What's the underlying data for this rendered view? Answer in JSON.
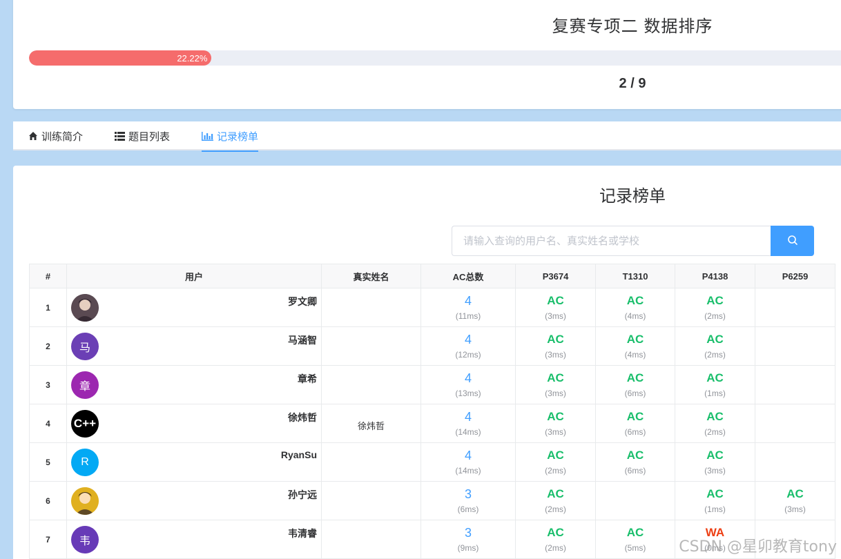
{
  "contest": {
    "title": "复赛专项二 数据排序",
    "progress_percent": 22.22,
    "progress_text": "22.22%",
    "progress_count": "2 / 9",
    "progress_color": "#f56c6c"
  },
  "tabs": [
    {
      "label": "训练简介",
      "icon": "home-icon",
      "active": false
    },
    {
      "label": "题目列表",
      "icon": "list-icon",
      "active": false
    },
    {
      "label": "记录榜单",
      "icon": "bar-chart-icon",
      "active": true
    }
  ],
  "board": {
    "title": "记录榜单",
    "search_placeholder": "请输入查询的用户名、真实姓名或学校",
    "columns": [
      "#",
      "用户",
      "真实姓名",
      "AC总数",
      "P3674",
      "T1310",
      "P4138",
      "P6259"
    ],
    "rows": [
      {
        "rank": "1",
        "user": "罗文卿",
        "avatar": {
          "type": "image",
          "label": "",
          "color": "#5a4a52"
        },
        "realname": "",
        "ac": "4",
        "total_time": "(11ms)",
        "cells": [
          {
            "v": "AC",
            "t": "(3ms)"
          },
          {
            "v": "AC",
            "t": "(4ms)"
          },
          {
            "v": "AC",
            "t": "(2ms)"
          },
          {
            "v": "",
            "t": ""
          }
        ]
      },
      {
        "rank": "2",
        "user": "马涵智",
        "avatar": {
          "type": "letter",
          "label": "马",
          "color": "#6b3fb5"
        },
        "realname": "",
        "ac": "4",
        "total_time": "(12ms)",
        "cells": [
          {
            "v": "AC",
            "t": "(3ms)"
          },
          {
            "v": "AC",
            "t": "(4ms)"
          },
          {
            "v": "AC",
            "t": "(2ms)"
          },
          {
            "v": "",
            "t": ""
          }
        ]
      },
      {
        "rank": "3",
        "user": "章希",
        "avatar": {
          "type": "letter",
          "label": "章",
          "color": "#9c27b0"
        },
        "realname": "",
        "ac": "4",
        "total_time": "(13ms)",
        "cells": [
          {
            "v": "AC",
            "t": "(3ms)"
          },
          {
            "v": "AC",
            "t": "(6ms)"
          },
          {
            "v": "AC",
            "t": "(1ms)"
          },
          {
            "v": "",
            "t": ""
          }
        ]
      },
      {
        "rank": "4",
        "user": "徐炜哲",
        "avatar": {
          "type": "cpp",
          "label": "C++",
          "color": "#000000"
        },
        "realname": "徐炜哲",
        "ac": "4",
        "total_time": "(14ms)",
        "cells": [
          {
            "v": "AC",
            "t": "(3ms)"
          },
          {
            "v": "AC",
            "t": "(6ms)"
          },
          {
            "v": "AC",
            "t": "(2ms)"
          },
          {
            "v": "",
            "t": ""
          }
        ]
      },
      {
        "rank": "5",
        "user": "RyanSu",
        "avatar": {
          "type": "letter",
          "label": "R",
          "color": "#03a9f4"
        },
        "realname": "",
        "ac": "4",
        "total_time": "(14ms)",
        "cells": [
          {
            "v": "AC",
            "t": "(2ms)"
          },
          {
            "v": "AC",
            "t": "(6ms)"
          },
          {
            "v": "AC",
            "t": "(3ms)"
          },
          {
            "v": "",
            "t": ""
          }
        ]
      },
      {
        "rank": "6",
        "user": "孙宁远",
        "avatar": {
          "type": "image",
          "label": "",
          "color": "#e0b020"
        },
        "realname": "",
        "ac": "3",
        "total_time": "(6ms)",
        "cells": [
          {
            "v": "AC",
            "t": "(2ms)"
          },
          {
            "v": "",
            "t": ""
          },
          {
            "v": "AC",
            "t": "(1ms)"
          },
          {
            "v": "AC",
            "t": "(3ms)"
          }
        ]
      },
      {
        "rank": "7",
        "user": "韦清睿",
        "avatar": {
          "type": "letter",
          "label": "韦",
          "color": "#673ab7"
        },
        "realname": "",
        "ac": "3",
        "total_time": "(9ms)",
        "cells": [
          {
            "v": "AC",
            "t": "(2ms)"
          },
          {
            "v": "AC",
            "t": "(5ms)"
          },
          {
            "v": "WA",
            "t": "(0ms)"
          },
          {
            "v": "",
            "t": ""
          }
        ]
      }
    ]
  },
  "watermark": "CSDN @星卯教育tony"
}
